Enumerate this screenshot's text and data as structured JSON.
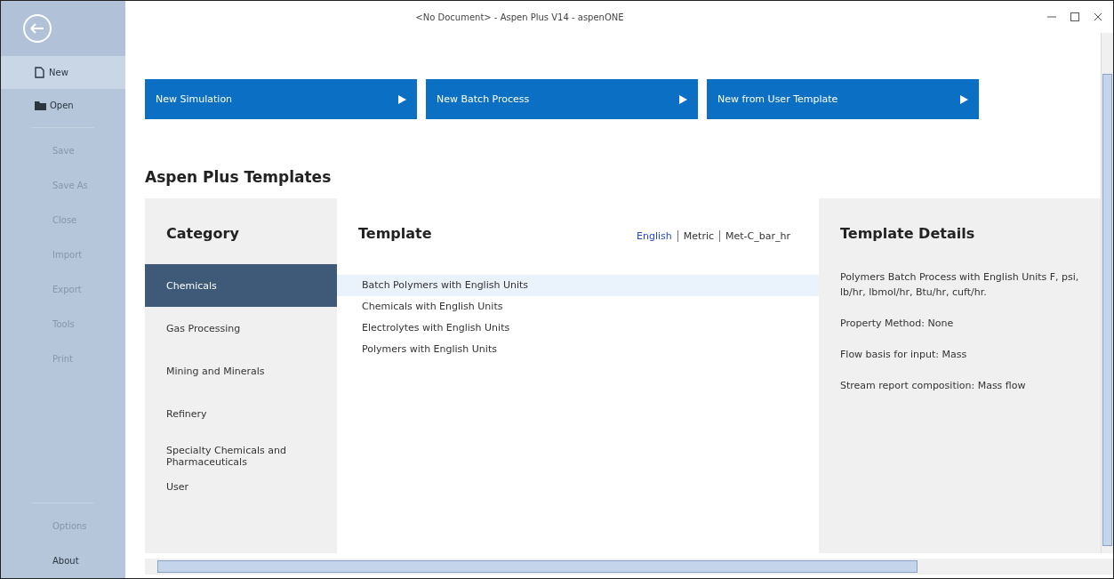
{
  "window": {
    "title": "<No Document> - Aspen Plus V14 - aspenONE"
  },
  "sidebar": {
    "items": [
      {
        "label": "New",
        "selected": true,
        "disabled": false,
        "kind": "new"
      },
      {
        "label": "Open",
        "selected": false,
        "disabled": false,
        "kind": "open"
      },
      {
        "label": "Save",
        "selected": false,
        "disabled": true,
        "kind": "plain"
      },
      {
        "label": "Save As",
        "selected": false,
        "disabled": true,
        "kind": "plain"
      },
      {
        "label": "Close",
        "selected": false,
        "disabled": true,
        "kind": "plain"
      },
      {
        "label": "Import",
        "selected": false,
        "disabled": true,
        "kind": "plain"
      },
      {
        "label": "Export",
        "selected": false,
        "disabled": true,
        "kind": "plain"
      },
      {
        "label": "Tools",
        "selected": false,
        "disabled": true,
        "kind": "plain"
      },
      {
        "label": "Print",
        "selected": false,
        "disabled": true,
        "kind": "plain"
      }
    ],
    "bottom_items": [
      {
        "label": "Options",
        "disabled": true
      },
      {
        "label": "About",
        "disabled": false
      }
    ]
  },
  "new_buttons": [
    "New Simulation",
    "New Batch Process",
    "New from User Template"
  ],
  "heading": "Aspen Plus Templates",
  "category": {
    "title": "Category",
    "items": [
      {
        "label": "Chemicals",
        "selected": true
      },
      {
        "label": "Gas Processing",
        "selected": false
      },
      {
        "label": "Mining and Minerals",
        "selected": false
      },
      {
        "label": "Refinery",
        "selected": false
      },
      {
        "label": "Specialty Chemicals and Pharmaceuticals",
        "selected": false
      },
      {
        "label": "User",
        "selected": false
      }
    ]
  },
  "template": {
    "title": "Template",
    "units": [
      {
        "label": "English",
        "selected": true
      },
      {
        "label": "Metric",
        "selected": false
      },
      {
        "label": "Met-C_bar_hr",
        "selected": false
      }
    ],
    "items": [
      {
        "label": "Batch Polymers with English Units",
        "selected": true
      },
      {
        "label": "Chemicals with English Units",
        "selected": false
      },
      {
        "label": "Electrolytes with English Units",
        "selected": false
      },
      {
        "label": "Polymers with English Units",
        "selected": false
      }
    ]
  },
  "details": {
    "title": "Template Details",
    "lines": [
      "Polymers Batch Process with English Units F, psi, lb/hr, lbmol/hr, Btu/hr, cuft/hr.",
      "Property Method: None",
      "Flow basis for input: Mass",
      "Stream report composition: Mass flow"
    ]
  }
}
